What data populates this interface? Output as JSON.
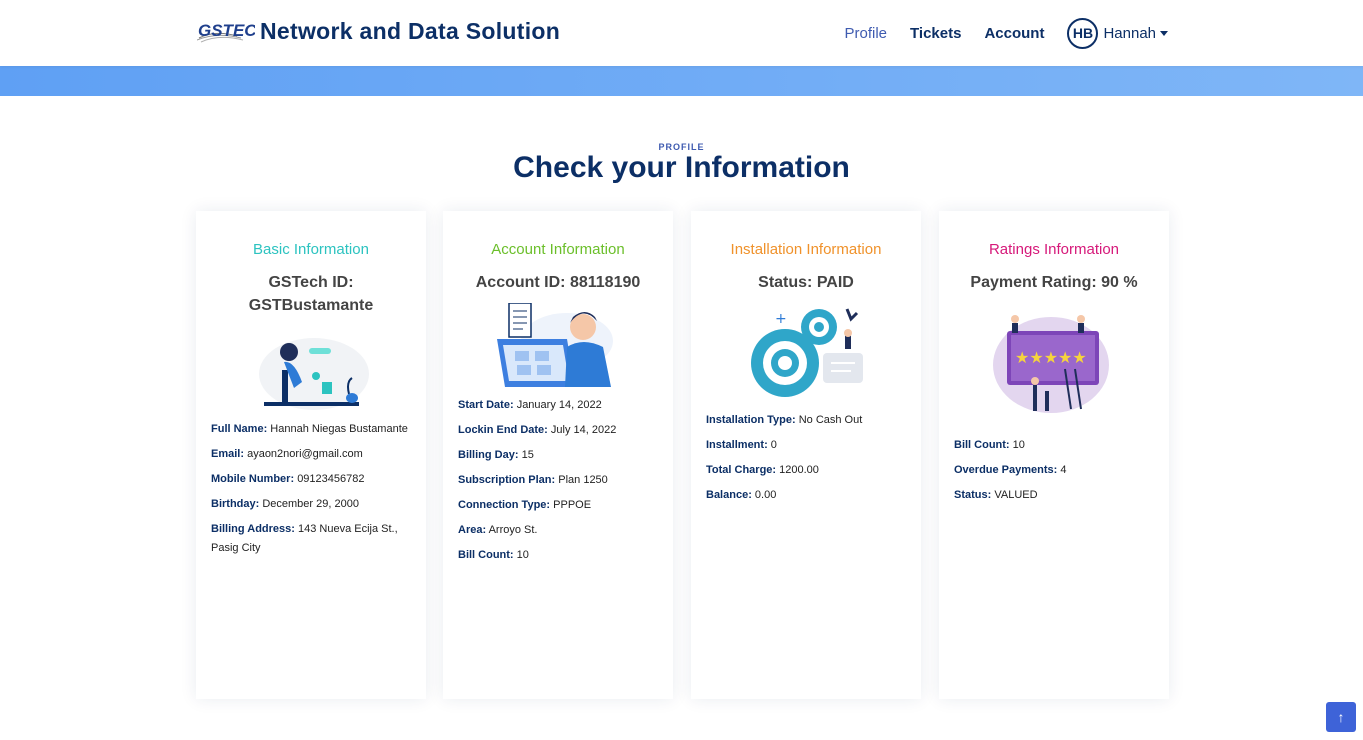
{
  "brand": {
    "logo_text": "GSTECH",
    "name": "Network and Data Solution"
  },
  "nav": {
    "links": [
      {
        "label": "Profile",
        "active": true
      },
      {
        "label": "Tickets",
        "active": false
      },
      {
        "label": "Account",
        "active": false
      }
    ],
    "user": {
      "initials": "HB",
      "name": "Hannah"
    }
  },
  "section": {
    "label": "PROFILE",
    "title": "Check your Information"
  },
  "cards": [
    {
      "title": "Basic Information",
      "title_color": "#2cc3c0",
      "subtitle": "GSTech ID: GSTBustamante",
      "icon": "person-at-desk-illustration",
      "fields": [
        {
          "label": "Full Name:",
          "value": "Hannah Niegas Bustamante"
        },
        {
          "label": "Email:",
          "value": "ayaon2nori@gmail.com"
        },
        {
          "label": "Mobile Number:",
          "value": "09123456782"
        },
        {
          "label": "Birthday:",
          "value": "December 29, 2000"
        },
        {
          "label": "Billing Address:",
          "value": "143 Nueva Ecija St., Pasig City"
        }
      ]
    },
    {
      "title": "Account Information",
      "title_color": "#6bbf2a",
      "subtitle": "Account ID: 88118190",
      "icon": "person-with-laptop-illustration",
      "fields": [
        {
          "label": "Start Date:",
          "value": "January 14, 2022"
        },
        {
          "label": "Lockin End Date:",
          "value": "July 14, 2022"
        },
        {
          "label": "Billing Day:",
          "value": "15"
        },
        {
          "label": "Subscription Plan:",
          "value": "Plan 1250"
        },
        {
          "label": "Connection Type:",
          "value": "PPPOE"
        },
        {
          "label": "Area:",
          "value": "Arroyo St."
        },
        {
          "label": "Bill Count:",
          "value": "10"
        }
      ]
    },
    {
      "title": "Installation Information",
      "title_color": "#f0922b",
      "subtitle": "Status: PAID",
      "icon": "gears-illustration",
      "fields": [
        {
          "label": "Installation Type:",
          "value": "No Cash Out"
        },
        {
          "label": "Installment:",
          "value": "0"
        },
        {
          "label": "Total Charge:",
          "value": "1200.00"
        },
        {
          "label": "Balance:",
          "value": "0.00"
        }
      ]
    },
    {
      "title": "Ratings Information",
      "title_color": "#d6197a",
      "subtitle": "Payment Rating: 90 %",
      "icon": "five-star-rating-illustration",
      "fields": [
        {
          "label": "Bill Count:",
          "value": "10"
        },
        {
          "label": "Overdue Payments:",
          "value": "4"
        },
        {
          "label": "Status:",
          "value": "VALUED"
        }
      ]
    }
  ],
  "scroll_top": {
    "icon": "arrow-up-icon",
    "glyph": "↑"
  }
}
